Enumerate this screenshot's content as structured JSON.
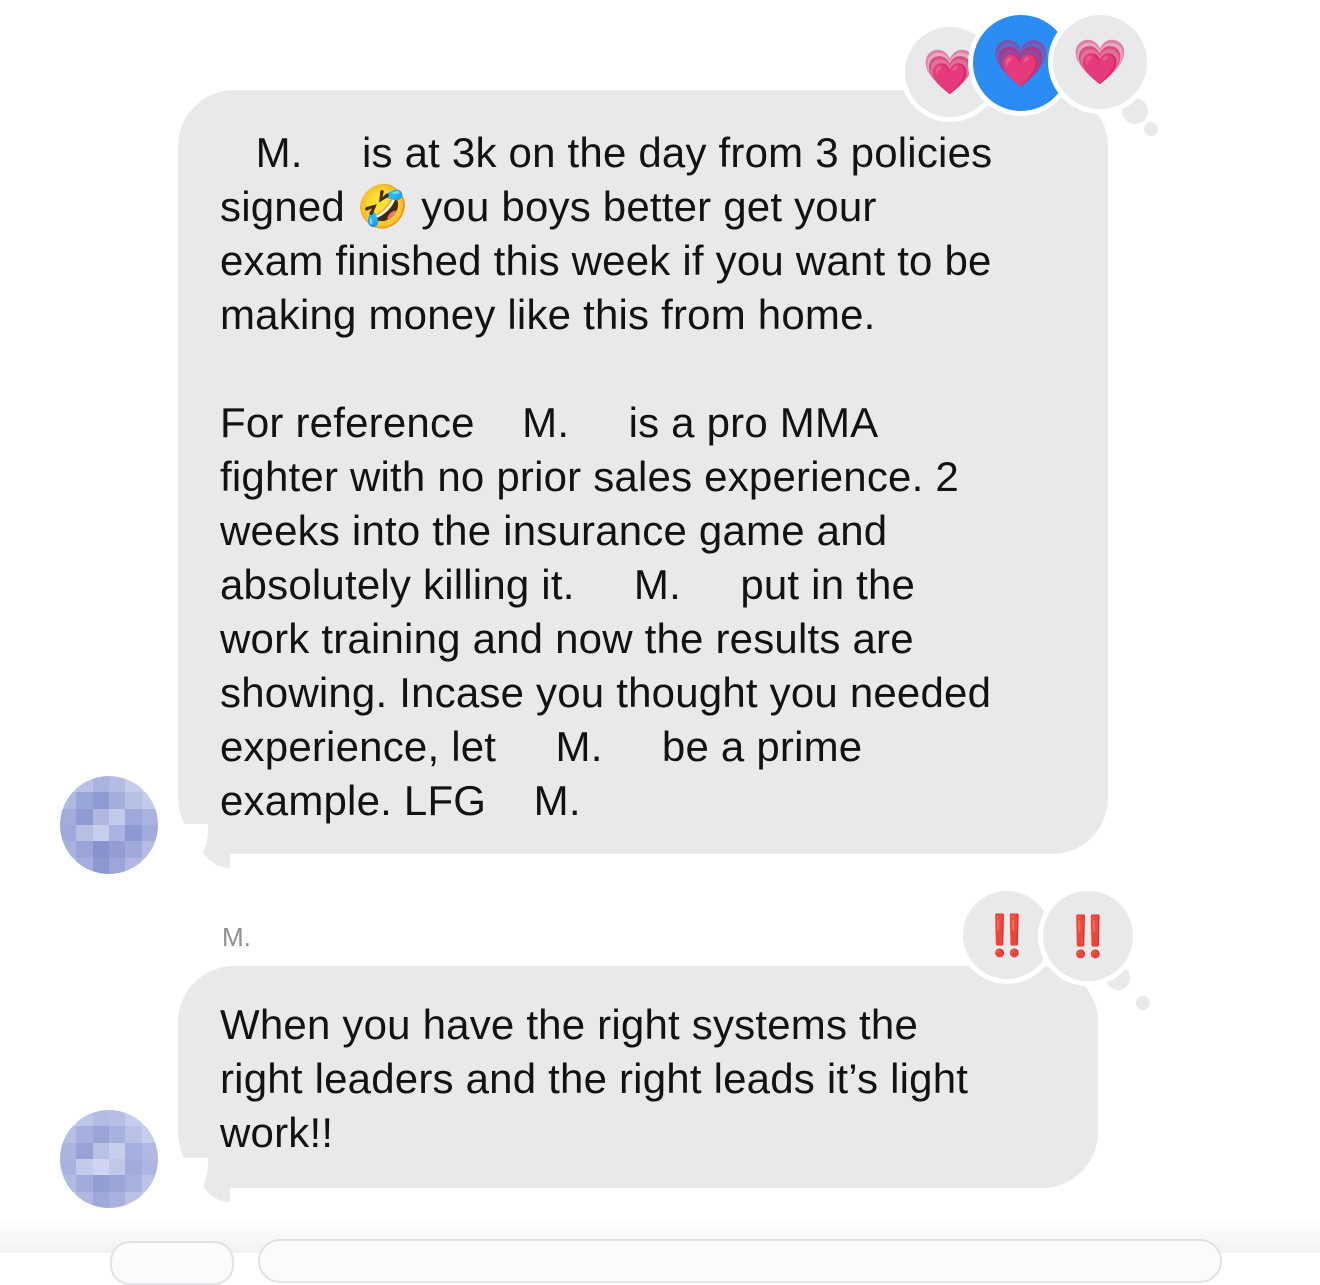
{
  "messages": [
    {
      "text": "   M.     is at 3k on the day from 3 policies\nsigned 🤣 you boys better get your\nexam finished this week if you want to be\nmaking money like this from home.\n\nFor reference    M.     is a pro MMA\nfighter with no prior sales experience. 2\nweeks into the insurance game and\nabsolutely killing it.     M.     put in the\nwork training and now the results are\nshowing. Incase you thought you needed\nexperience, let     M.     be a prime\nexample. LFG    M.",
      "reactions": [
        "💗",
        "💗",
        "💗"
      ]
    },
    {
      "sender": "M.",
      "text": "When you have the right systems the\nright leaders and the right leads it’s light\nwork!!",
      "reactions": [
        "‼️",
        "‼️"
      ]
    }
  ],
  "colors": {
    "bubble": "#e9e9eb",
    "reaction_mine": "#2a8cf5",
    "sender_name": "#8e8e93"
  }
}
